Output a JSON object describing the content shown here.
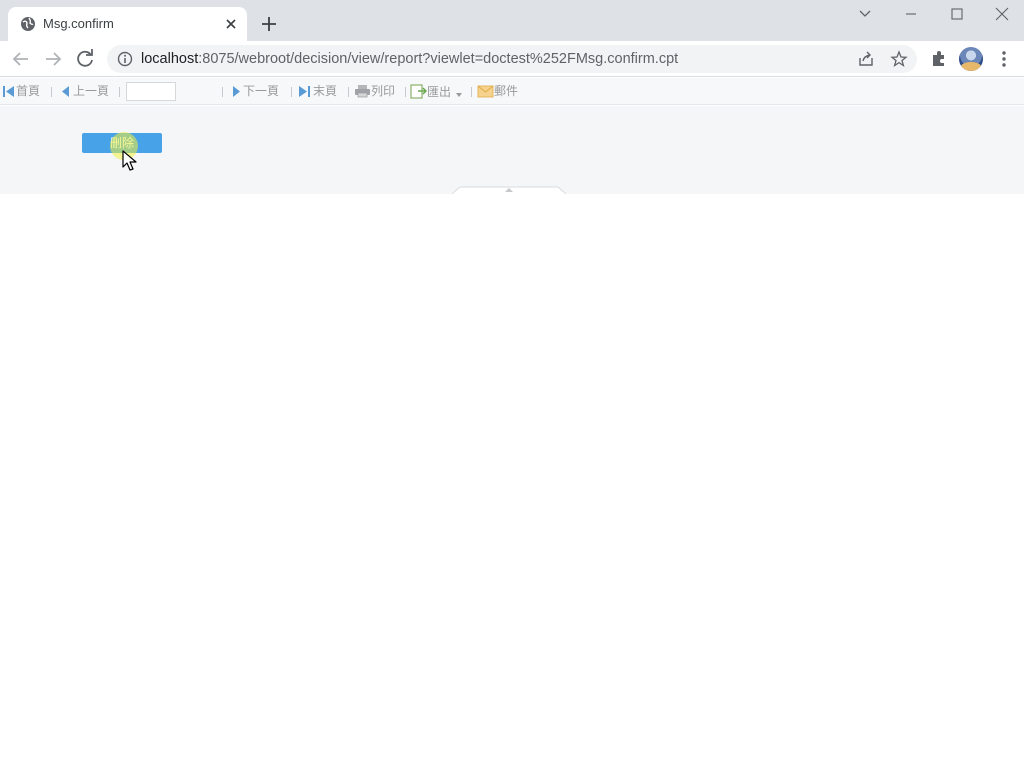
{
  "browser": {
    "tab_title": "Msg.confirm",
    "url_host": "localhost",
    "url_rest": ":8075/webroot/decision/view/report?viewlet=doctest%252FMsg.confirm.cpt"
  },
  "report_toolbar": {
    "first_page": "首頁",
    "prev_page": "上一頁",
    "page_value": "",
    "next_page": "下一頁",
    "last_page": "末頁",
    "print": "列印",
    "export": "匯出",
    "email": "郵件"
  },
  "report": {
    "delete_button": "刪除"
  },
  "colors": {
    "accent": "#48a2e8",
    "toolbar_icon_blue": "#5b9bd5"
  }
}
